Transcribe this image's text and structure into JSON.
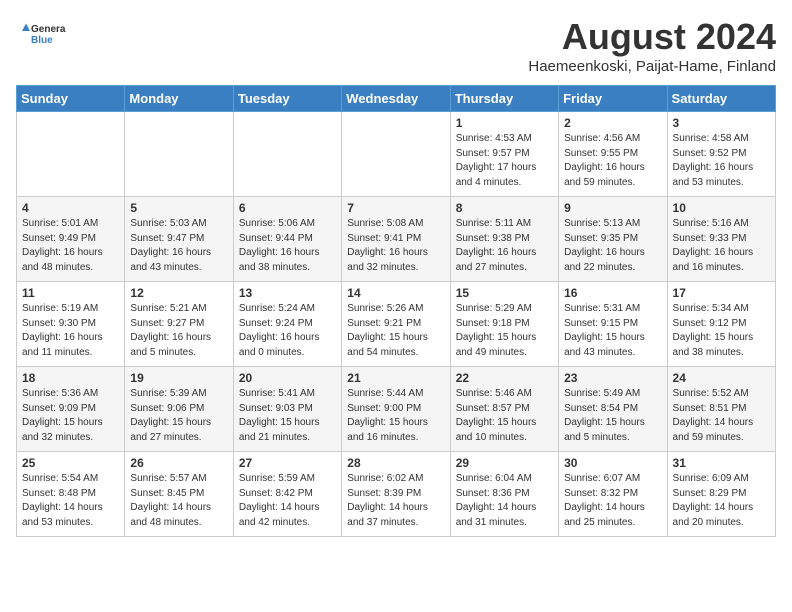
{
  "logo": {
    "text_general": "General",
    "text_blue": "Blue"
  },
  "title": "August 2024",
  "subtitle": "Haemeenkoski, Paijat-Hame, Finland",
  "days_of_week": [
    "Sunday",
    "Monday",
    "Tuesday",
    "Wednesday",
    "Thursday",
    "Friday",
    "Saturday"
  ],
  "weeks": [
    [
      {
        "day": "",
        "info": ""
      },
      {
        "day": "",
        "info": ""
      },
      {
        "day": "",
        "info": ""
      },
      {
        "day": "",
        "info": ""
      },
      {
        "day": "1",
        "info": "Sunrise: 4:53 AM\nSunset: 9:57 PM\nDaylight: 17 hours\nand 4 minutes."
      },
      {
        "day": "2",
        "info": "Sunrise: 4:56 AM\nSunset: 9:55 PM\nDaylight: 16 hours\nand 59 minutes."
      },
      {
        "day": "3",
        "info": "Sunrise: 4:58 AM\nSunset: 9:52 PM\nDaylight: 16 hours\nand 53 minutes."
      }
    ],
    [
      {
        "day": "4",
        "info": "Sunrise: 5:01 AM\nSunset: 9:49 PM\nDaylight: 16 hours\nand 48 minutes."
      },
      {
        "day": "5",
        "info": "Sunrise: 5:03 AM\nSunset: 9:47 PM\nDaylight: 16 hours\nand 43 minutes."
      },
      {
        "day": "6",
        "info": "Sunrise: 5:06 AM\nSunset: 9:44 PM\nDaylight: 16 hours\nand 38 minutes."
      },
      {
        "day": "7",
        "info": "Sunrise: 5:08 AM\nSunset: 9:41 PM\nDaylight: 16 hours\nand 32 minutes."
      },
      {
        "day": "8",
        "info": "Sunrise: 5:11 AM\nSunset: 9:38 PM\nDaylight: 16 hours\nand 27 minutes."
      },
      {
        "day": "9",
        "info": "Sunrise: 5:13 AM\nSunset: 9:35 PM\nDaylight: 16 hours\nand 22 minutes."
      },
      {
        "day": "10",
        "info": "Sunrise: 5:16 AM\nSunset: 9:33 PM\nDaylight: 16 hours\nand 16 minutes."
      }
    ],
    [
      {
        "day": "11",
        "info": "Sunrise: 5:19 AM\nSunset: 9:30 PM\nDaylight: 16 hours\nand 11 minutes."
      },
      {
        "day": "12",
        "info": "Sunrise: 5:21 AM\nSunset: 9:27 PM\nDaylight: 16 hours\nand 5 minutes."
      },
      {
        "day": "13",
        "info": "Sunrise: 5:24 AM\nSunset: 9:24 PM\nDaylight: 16 hours\nand 0 minutes."
      },
      {
        "day": "14",
        "info": "Sunrise: 5:26 AM\nSunset: 9:21 PM\nDaylight: 15 hours\nand 54 minutes."
      },
      {
        "day": "15",
        "info": "Sunrise: 5:29 AM\nSunset: 9:18 PM\nDaylight: 15 hours\nand 49 minutes."
      },
      {
        "day": "16",
        "info": "Sunrise: 5:31 AM\nSunset: 9:15 PM\nDaylight: 15 hours\nand 43 minutes."
      },
      {
        "day": "17",
        "info": "Sunrise: 5:34 AM\nSunset: 9:12 PM\nDaylight: 15 hours\nand 38 minutes."
      }
    ],
    [
      {
        "day": "18",
        "info": "Sunrise: 5:36 AM\nSunset: 9:09 PM\nDaylight: 15 hours\nand 32 minutes."
      },
      {
        "day": "19",
        "info": "Sunrise: 5:39 AM\nSunset: 9:06 PM\nDaylight: 15 hours\nand 27 minutes."
      },
      {
        "day": "20",
        "info": "Sunrise: 5:41 AM\nSunset: 9:03 PM\nDaylight: 15 hours\nand 21 minutes."
      },
      {
        "day": "21",
        "info": "Sunrise: 5:44 AM\nSunset: 9:00 PM\nDaylight: 15 hours\nand 16 minutes."
      },
      {
        "day": "22",
        "info": "Sunrise: 5:46 AM\nSunset: 8:57 PM\nDaylight: 15 hours\nand 10 minutes."
      },
      {
        "day": "23",
        "info": "Sunrise: 5:49 AM\nSunset: 8:54 PM\nDaylight: 15 hours\nand 5 minutes."
      },
      {
        "day": "24",
        "info": "Sunrise: 5:52 AM\nSunset: 8:51 PM\nDaylight: 14 hours\nand 59 minutes."
      }
    ],
    [
      {
        "day": "25",
        "info": "Sunrise: 5:54 AM\nSunset: 8:48 PM\nDaylight: 14 hours\nand 53 minutes."
      },
      {
        "day": "26",
        "info": "Sunrise: 5:57 AM\nSunset: 8:45 PM\nDaylight: 14 hours\nand 48 minutes."
      },
      {
        "day": "27",
        "info": "Sunrise: 5:59 AM\nSunset: 8:42 PM\nDaylight: 14 hours\nand 42 minutes."
      },
      {
        "day": "28",
        "info": "Sunrise: 6:02 AM\nSunset: 8:39 PM\nDaylight: 14 hours\nand 37 minutes."
      },
      {
        "day": "29",
        "info": "Sunrise: 6:04 AM\nSunset: 8:36 PM\nDaylight: 14 hours\nand 31 minutes."
      },
      {
        "day": "30",
        "info": "Sunrise: 6:07 AM\nSunset: 8:32 PM\nDaylight: 14 hours\nand 25 minutes."
      },
      {
        "day": "31",
        "info": "Sunrise: 6:09 AM\nSunset: 8:29 PM\nDaylight: 14 hours\nand 20 minutes."
      }
    ]
  ]
}
